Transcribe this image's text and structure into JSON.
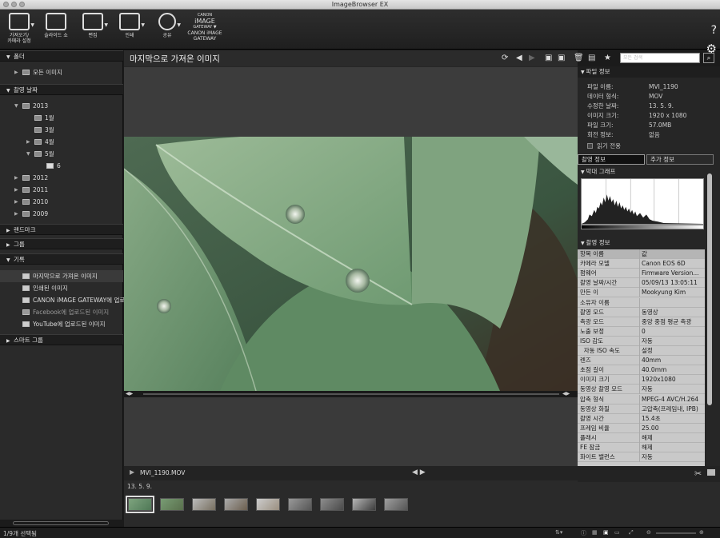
{
  "window": {
    "title": "ImageBrowser EX"
  },
  "toolbar": {
    "items": [
      {
        "label": "가져오기/\n카메라 설정"
      },
      {
        "label": "슬라이드 쇼"
      },
      {
        "label": "편집"
      },
      {
        "label": "인쇄"
      },
      {
        "label": "공유"
      },
      {
        "label": "CANON iMAGE\nGATEWAY",
        "logo": "CANON iMAGE GATEWAY"
      }
    ],
    "help_icon": "?",
    "settings_icon": "gear-icon"
  },
  "sidebar": {
    "folders": {
      "header": "폴더",
      "items": [
        "모든 이미지"
      ]
    },
    "shoot_date": {
      "header": "촬영 날짜",
      "tree": [
        {
          "label": "2013",
          "level": 0
        },
        {
          "label": "1월",
          "level": 1
        },
        {
          "label": "3월",
          "level": 1
        },
        {
          "label": "4월",
          "level": 1
        },
        {
          "label": "5월",
          "level": 1
        },
        {
          "label": "6",
          "level": 2
        },
        {
          "label": "2012",
          "level": 0
        },
        {
          "label": "2011",
          "level": 0
        },
        {
          "label": "2010",
          "level": 0
        },
        {
          "label": "2009",
          "level": 0
        }
      ]
    },
    "landmarks": {
      "header": "랜드마크"
    },
    "groups": {
      "header": "그룹"
    },
    "records": {
      "header": "기록",
      "items": [
        "마지막으로 가져온 이미지",
        "인쇄된 이미지",
        "CANON iMAGE GATEWAY에 업로",
        "Facebook에 업로드된 이미지",
        "YouTube에 업로드된 이미지"
      ]
    },
    "smart_groups": {
      "header": "스마트 그룹"
    }
  },
  "main": {
    "title": "마지막으로 가져온 이미지",
    "search_placeholder": "모든 검색",
    "file_name": "MVI_1190.MOV",
    "strip_date": "13. 5. 9.",
    "thumbnail_count": 9
  },
  "file_info": {
    "header": "파일 정보",
    "rows": [
      {
        "k": "파일 이름:",
        "v": "MVI_1190"
      },
      {
        "k": "데이터 형식:",
        "v": "MOV"
      },
      {
        "k": "수정한 날짜:",
        "v": "13. 5. 9."
      },
      {
        "k": "이미지 크기:",
        "v": "1920 x 1080"
      },
      {
        "k": "파일 크기:",
        "v": "57.0MB"
      },
      {
        "k": "회전 정보:",
        "v": "없음"
      }
    ],
    "read_only": "읽기 전용"
  },
  "tabs": {
    "shooting": "촬영 정보",
    "extra": "추가 정보"
  },
  "histogram": {
    "header": "막대 그래프"
  },
  "shooting_info": {
    "header": "촬영 정보",
    "columns": [
      "항목 이름",
      "값"
    ],
    "rows": [
      [
        "카메라 모델",
        "Canon EOS 6D"
      ],
      [
        "펌웨어",
        "Firmware Version..."
      ],
      [
        "촬영 날짜/시간",
        "05/09/13 13:05:11"
      ],
      [
        "만든 이",
        "Mookyung Kim"
      ],
      [
        "소유자 이름",
        ""
      ],
      [
        "촬영 모드",
        "동영상"
      ],
      [
        "측광 모드",
        "중앙 중점 평균 측광"
      ],
      [
        "노출 보정",
        "0"
      ],
      [
        "ISO 감도",
        "자동"
      ],
      [
        "  자동 ISO 속도",
        "설정"
      ],
      [
        "렌즈",
        "40mm"
      ],
      [
        "초점 길이",
        "40.0mm"
      ],
      [
        "이미지 크기",
        "1920x1080"
      ],
      [
        "동영상 촬영 모드",
        "자동"
      ],
      [
        "압축 형식",
        "MPEG-4 AVC/H.264"
      ],
      [
        "동영상 화질",
        "고압축(프레임내, IPB)"
      ],
      [
        "촬영 시간",
        "15.4초"
      ],
      [
        "프레임 비율",
        "25.00"
      ],
      [
        "플래시",
        "해제"
      ],
      [
        "FE 잠금",
        "해제"
      ],
      [
        "화이트 밸런스",
        "자동"
      ]
    ]
  },
  "status": {
    "selection": "1/9개 선택됨"
  }
}
